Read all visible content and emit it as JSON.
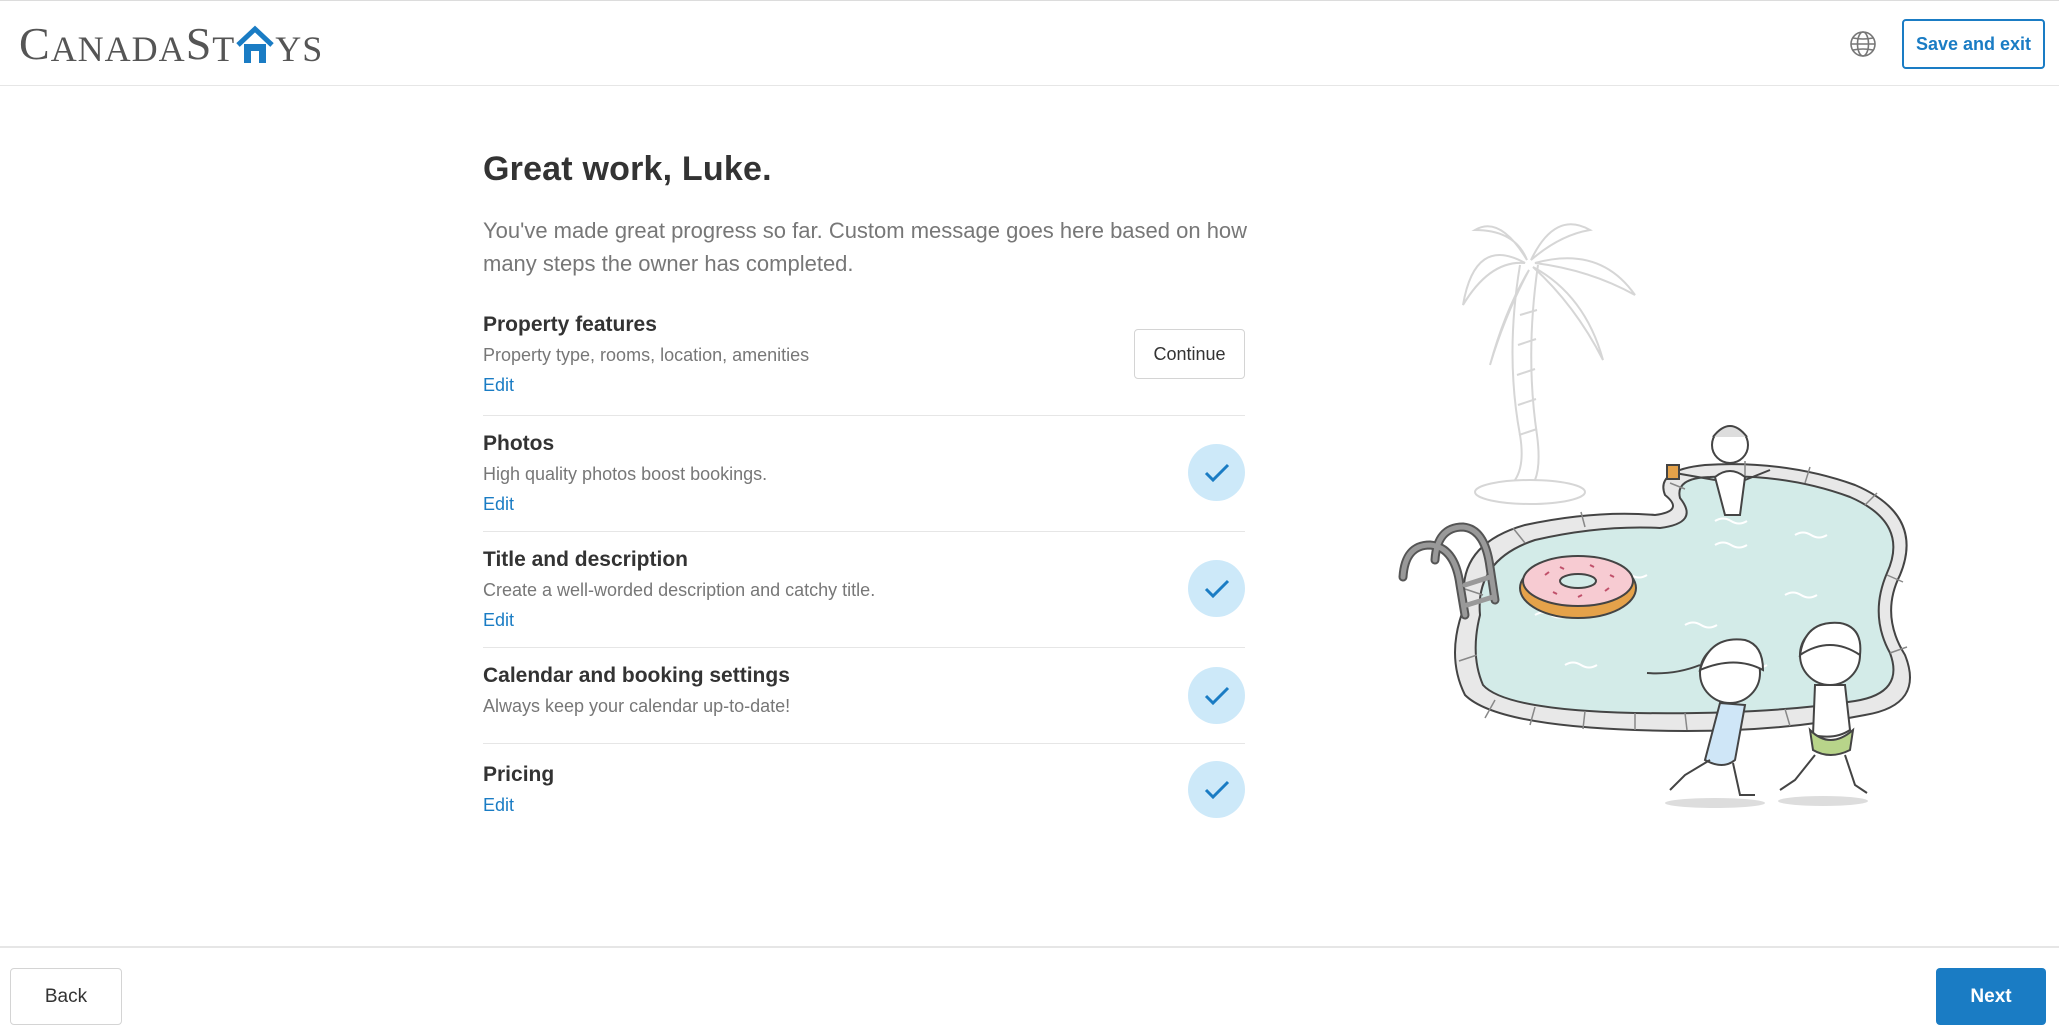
{
  "header": {
    "logo_part1": "C",
    "logo_part2": "ANADA",
    "logo_part3": "S",
    "logo_part4": "T",
    "logo_part5": "YS",
    "logo_text": "CanadaStays",
    "save_exit_label": "Save and exit",
    "language_icon": "globe-icon"
  },
  "main": {
    "title": "Great work, Luke.",
    "intro": "You've made great progress so far. Custom message goes here based on how many steps the owner has completed.",
    "steps": [
      {
        "title": "Property features",
        "description": "Property type, rooms, location, amenities",
        "edit_label": "Edit",
        "status": "incomplete",
        "action_label": "Continue"
      },
      {
        "title": "Photos",
        "description": "High quality photos boost bookings.",
        "edit_label": "Edit",
        "status": "complete"
      },
      {
        "title": "Title and description",
        "description": "Create a well-worded description and catchy title.",
        "edit_label": "Edit",
        "status": "complete"
      },
      {
        "title": "Calendar and booking settings",
        "description": "Always keep your calendar up-to-date!",
        "status": "complete"
      },
      {
        "title": "Pricing",
        "edit_label": "Edit",
        "status": "complete"
      }
    ]
  },
  "footer": {
    "back_label": "Back",
    "next_label": "Next"
  },
  "colors": {
    "accent": "#1a7cc4",
    "check_bg": "#cde9f9",
    "pool_water": "#d3ebe8"
  }
}
